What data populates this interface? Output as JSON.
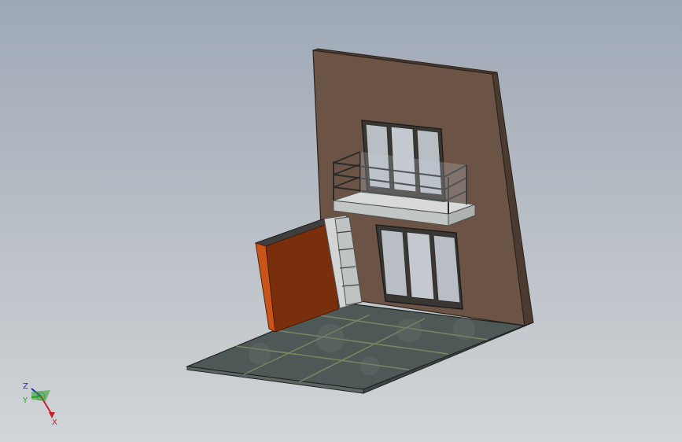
{
  "viewport": {
    "background_top": "#9ea8b6",
    "background_bottom": "#d2d5d8"
  },
  "model": {
    "name": "building-facade-with-balcony",
    "colors": {
      "wall_face": "#6b5446",
      "wall_edge": "#3d2f27",
      "floor": "#4e5856",
      "floor_edge": "#1e2322",
      "side_wall_front": "#7a2f0c",
      "side_wall_edge": "#b24a12",
      "shelf": "#d2d5d3",
      "balcony_slab": "#cfd2d1",
      "railing": "#2a2a2a",
      "window_glass": "#b8bec4",
      "window_frame": "#2e2e2e"
    }
  },
  "triad": {
    "x_label": "X",
    "y_label": "Y",
    "z_label": "Z",
    "x_color": "#c8202a",
    "y_color": "#28a028",
    "z_color": "#2030b0"
  }
}
